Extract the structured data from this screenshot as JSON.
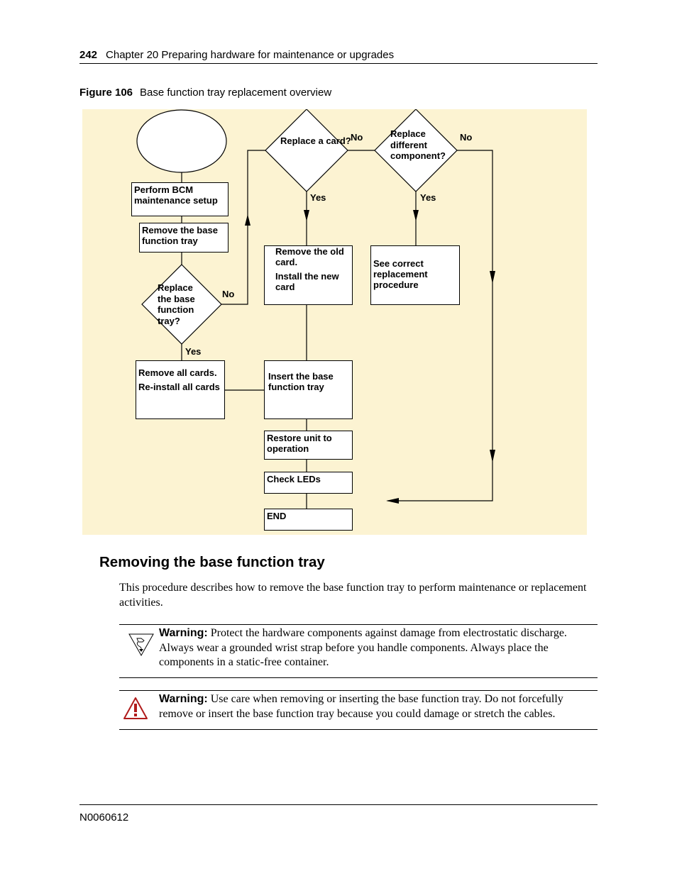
{
  "header": {
    "page_number": "242",
    "chapter": "Chapter 20  Preparing hardware for maintenance or upgrades"
  },
  "figure": {
    "label": "Figure 106",
    "title": "Base function tray replacement overview",
    "nodes": {
      "start": "",
      "perform_setup": "Perform BCM maintenance setup",
      "remove_tray": "Remove the base function tray",
      "decision_replace_tray": "Replace the base function tray?",
      "remove_all_cards": "Remove all cards.",
      "reinstall_cards": "Re-install all cards",
      "decision_replace_card": "Replace a card?",
      "remove_old_card": "Remove the old card.",
      "install_new_card": "Install the new card",
      "decision_replace_other": "Replace different component?",
      "see_procedure": "See correct replacement procedure",
      "insert_tray": "Insert the base function tray",
      "restore_unit": "Restore unit to operation",
      "check_leds": "Check LEDs",
      "end": "END"
    },
    "labels": {
      "yes": "Yes",
      "no": "No"
    },
    "colors": {
      "background": "#fcf3d2",
      "node_fill": "#ffffff",
      "stroke": "#000000"
    }
  },
  "section": {
    "title": "Removing the base function tray",
    "intro": "This procedure describes how to remove the base function tray to perform maintenance or replacement activities."
  },
  "warnings": [
    {
      "icon": "esd-icon",
      "label": "Warning:",
      "text": " Protect the hardware components against damage from electrostatic discharge. Always wear a grounded wrist strap before you handle components. Always place the components in a static-free container."
    },
    {
      "icon": "caution-triangle-icon",
      "label": "Warning:",
      "text": " Use care when removing or inserting the base function tray. Do not forcefully remove or insert the base function tray because you could damage or stretch the cables.",
      "icon_color": "#b01c1c"
    }
  ],
  "footer": {
    "doc_id": "N0060612"
  }
}
